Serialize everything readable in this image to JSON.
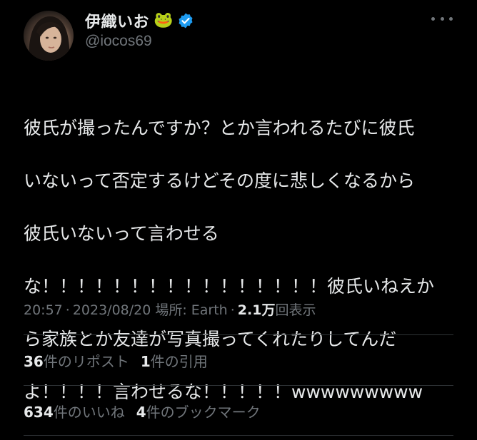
{
  "tweet": {
    "author": {
      "display_name": "伊織いお",
      "emoji": "🐸",
      "verified_icon": "verified-badge-icon",
      "handle": "@iocos69"
    },
    "lines": [
      "彼氏が撮ったんですか？とか言われるたびに彼氏",
      "いないって否定するけどその度に悲しくなるから",
      "彼氏いないって言わせる",
      "な！！！！！！！！！！！！！！！！彼氏いねえか",
      "ら家族とか友達が写真撮ってくれたりしてんだ",
      "よ！！！！言わせるな！！！！！wwwwwwwww"
    ],
    "meta": {
      "time": "20:57",
      "date": "2023/08/20",
      "location": "場所: Earth",
      "views_count": "2.1万",
      "views_label": "回表示"
    },
    "stats": {
      "reposts_count": "36",
      "reposts_label": "件のリポスト",
      "quotes_count": "1",
      "quotes_label": "件の引用",
      "likes_count": "634",
      "likes_label": "件のいいね",
      "bookmarks_count": "4",
      "bookmarks_label": "件のブックマーク"
    }
  },
  "colors": {
    "background": "#000000",
    "text": "#e7e9ea",
    "secondary": "#71767b",
    "verified": "#1d9bf0",
    "divider": "#2f3336"
  }
}
